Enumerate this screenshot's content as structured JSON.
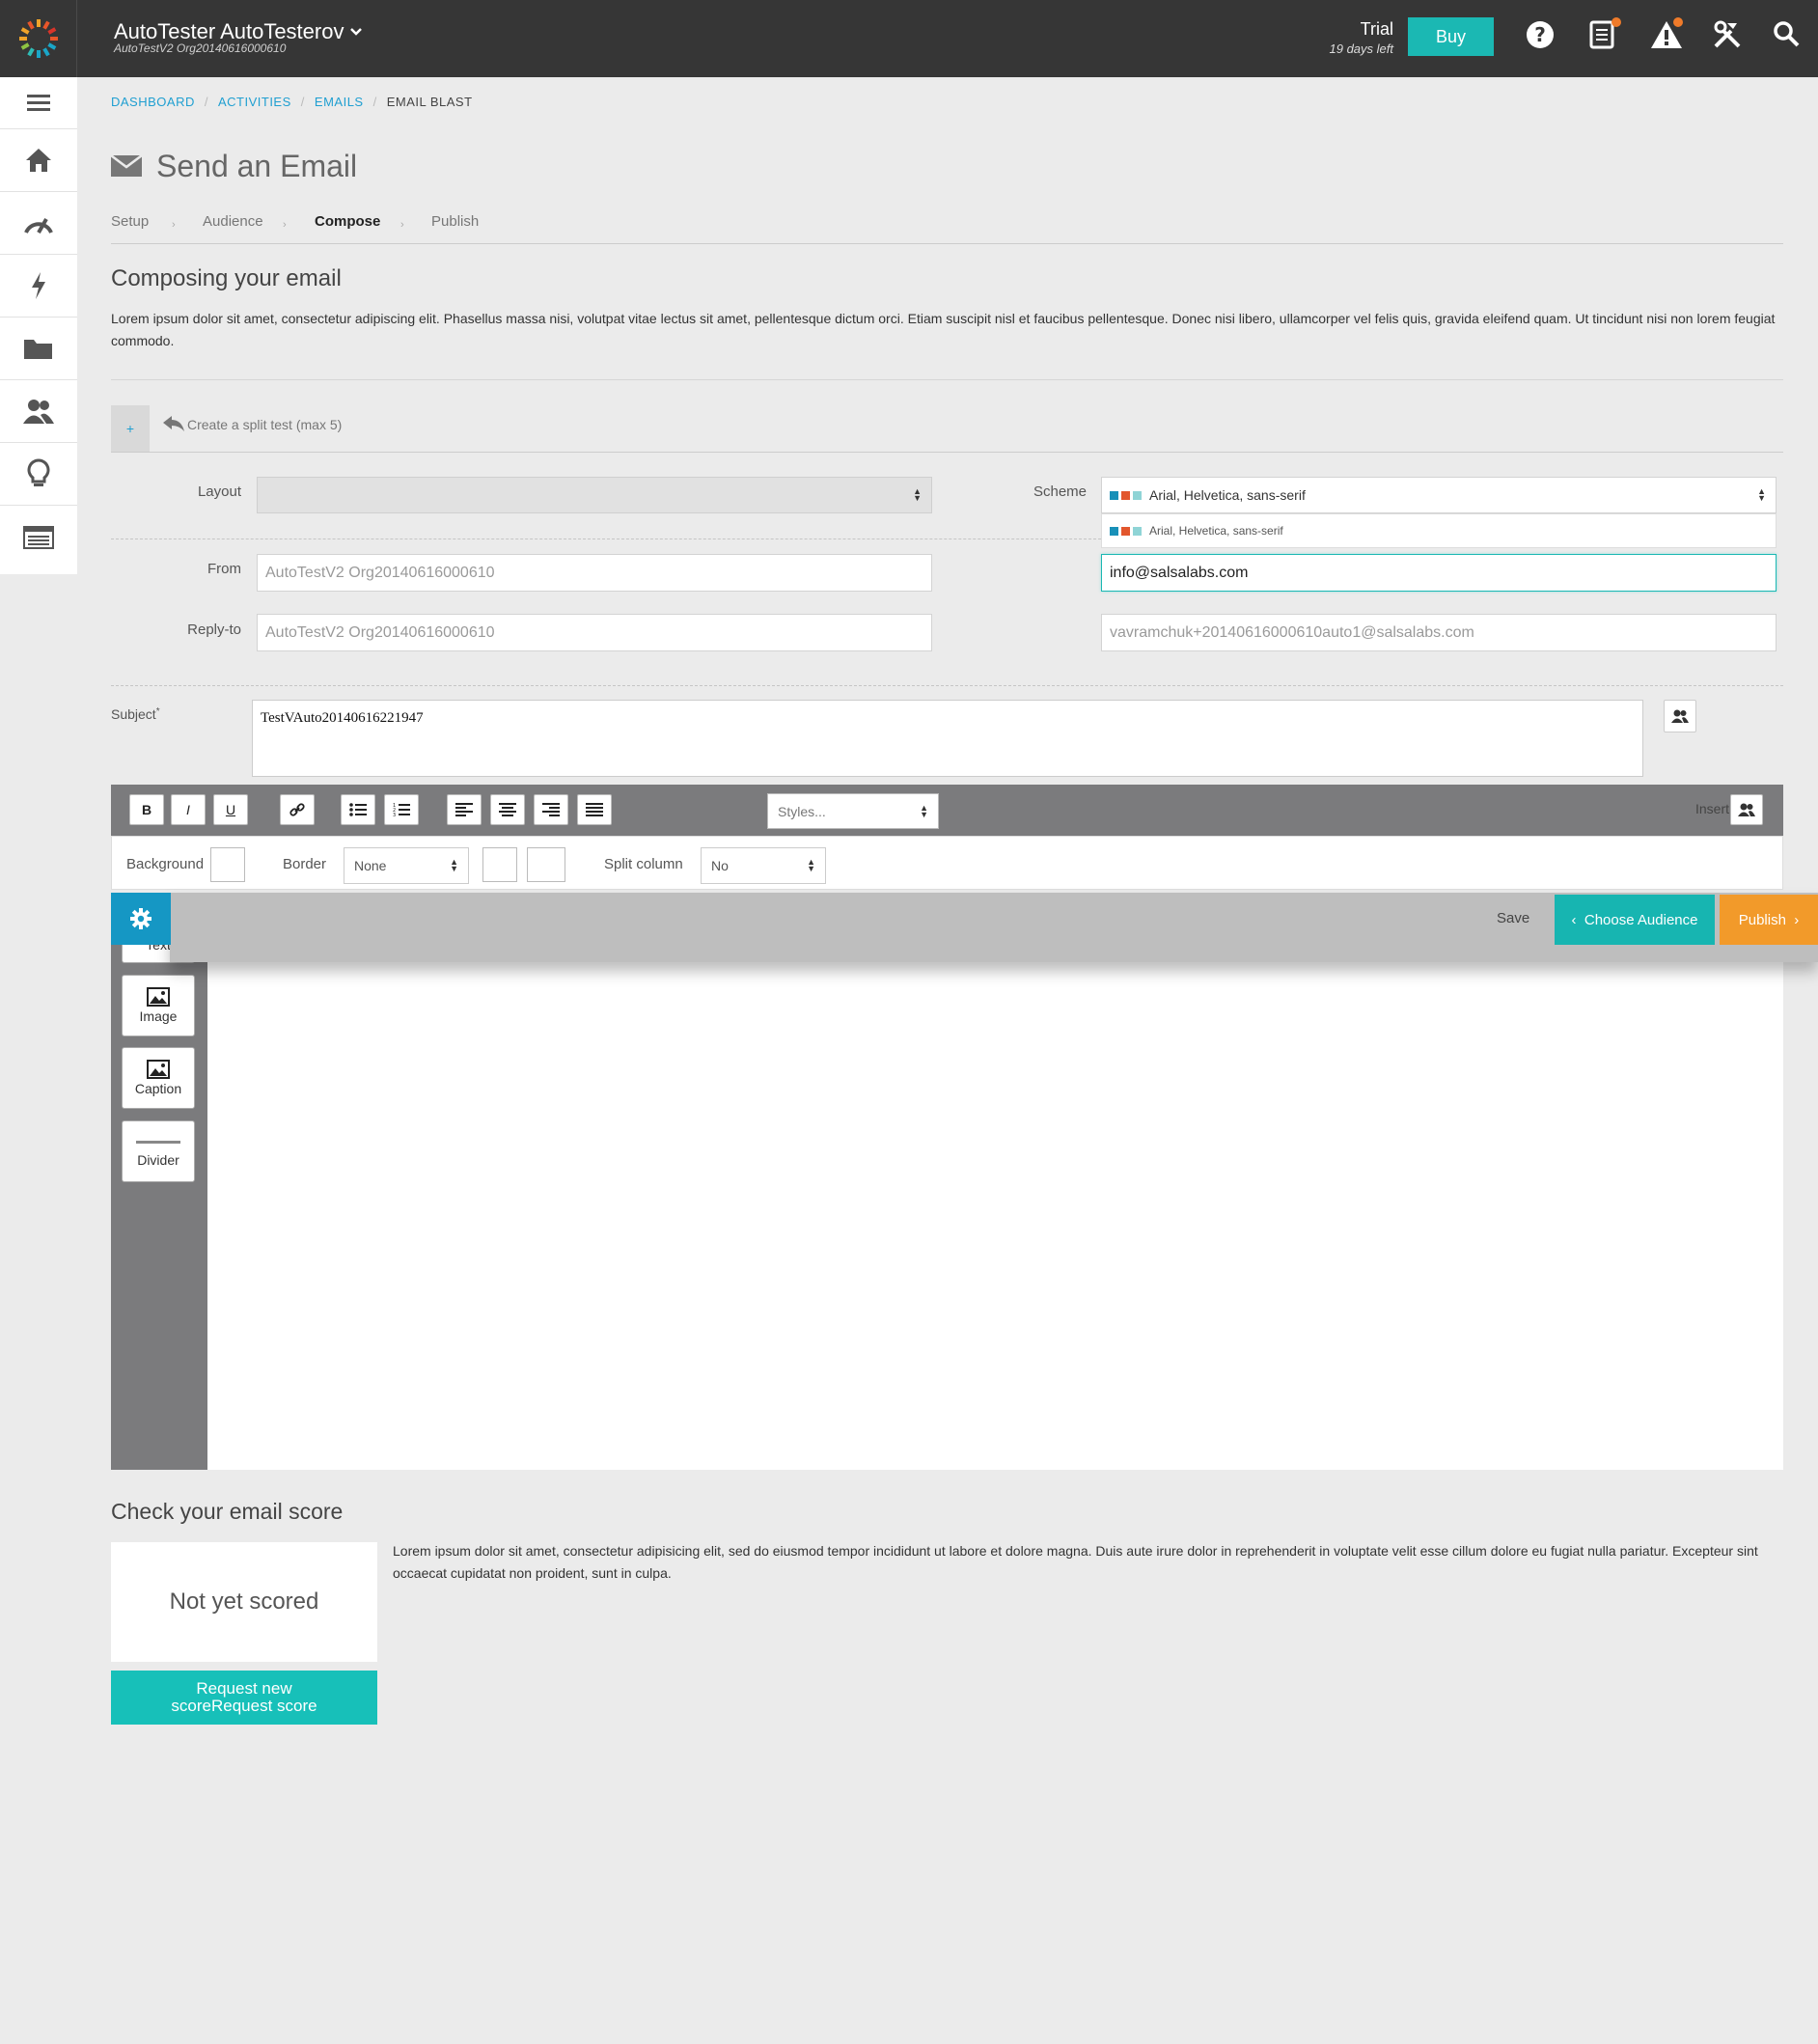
{
  "header": {
    "account_name": "AutoTester AutoTesterov",
    "account_org": "AutoTestV2 Org20140616000610",
    "trial_label": "Trial",
    "trial_days": "19 days left",
    "buy_label": "Buy"
  },
  "breadcrumb": {
    "items": [
      "DASHBOARD",
      "ACTIVITIES",
      "EMAILS"
    ],
    "current": "EMAIL BLAST"
  },
  "page": {
    "title": "Send an Email"
  },
  "steps": [
    "Setup",
    "Audience",
    "Compose",
    "Publish"
  ],
  "compose": {
    "title": "Composing your email",
    "description": "Lorem ipsum dolor sit amet, consectetur adipiscing elit. Phasellus massa nisi, volutpat vitae lectus sit amet, pellentesque dictum orci. Etiam suscipit nisl et faucibus pellentesque. Donec nisi libero, ullamcorper vel felis quis, gravida eleifend quam. Ut tincidunt nisi non lorem feugiat commodo.",
    "split_test_label": "Create a split test (max 5)",
    "split_plus": "+"
  },
  "form": {
    "layout_label": "Layout",
    "layout_value": "",
    "scheme_label": "Scheme",
    "scheme_value": "Arial, Helvetica, sans-serif",
    "scheme_option": "Arial, Helvetica, sans-serif",
    "scheme_colors": [
      "#1890b8",
      "#e2562d",
      "#8fd4d6"
    ],
    "from_label": "From",
    "from_name_placeholder": "AutoTestV2 Org20140616000610",
    "from_email": "info@salsalabs.com",
    "reply_label": "Reply-to",
    "reply_name_placeholder": "AutoTestV2 Org20140616000610",
    "reply_email_placeholder": "vavramchuk+20140616000610auto1@salsalabs.com",
    "subject_label": "Subject",
    "subject_required": "*",
    "subject_value": "TestVAuto20140616221947"
  },
  "toolbar": {
    "bold": "B",
    "italic": "I",
    "underline": "U",
    "styles_placeholder": "Styles...",
    "insert_label": "Insert",
    "background_label": "Background",
    "border_label": "Border",
    "border_value": "None",
    "split_column_label": "Split column",
    "split_column_value": "No"
  },
  "palette": {
    "text_label": "Text",
    "image_label": "Image",
    "caption_label": "Caption",
    "divider_label": "Divider"
  },
  "actions": {
    "save_label": "Save",
    "choose_audience_label": "Choose Audience",
    "publish_label": "Publish"
  },
  "score": {
    "title": "Check your email score",
    "status": "Not yet scored",
    "description": "Lorem ipsum dolor sit amet, consectetur adipisicing elit, sed do eiusmod tempor incididunt ut labore et dolore magna. Duis aute irure dolor in reprehenderit in voluptate velit esse cillum dolore eu fugiat nulla pariatur. Excepteur sint occaecat cupidatat non proident, sunt in culpa.",
    "request_label": "Request new scoreRequest score"
  },
  "colors": {
    "topbar": "#363636",
    "accent_teal": "#17b5b1",
    "accent_blue": "#1597c4",
    "publish_orange": "#f29a2a",
    "link_blue": "#1f9fd1"
  }
}
